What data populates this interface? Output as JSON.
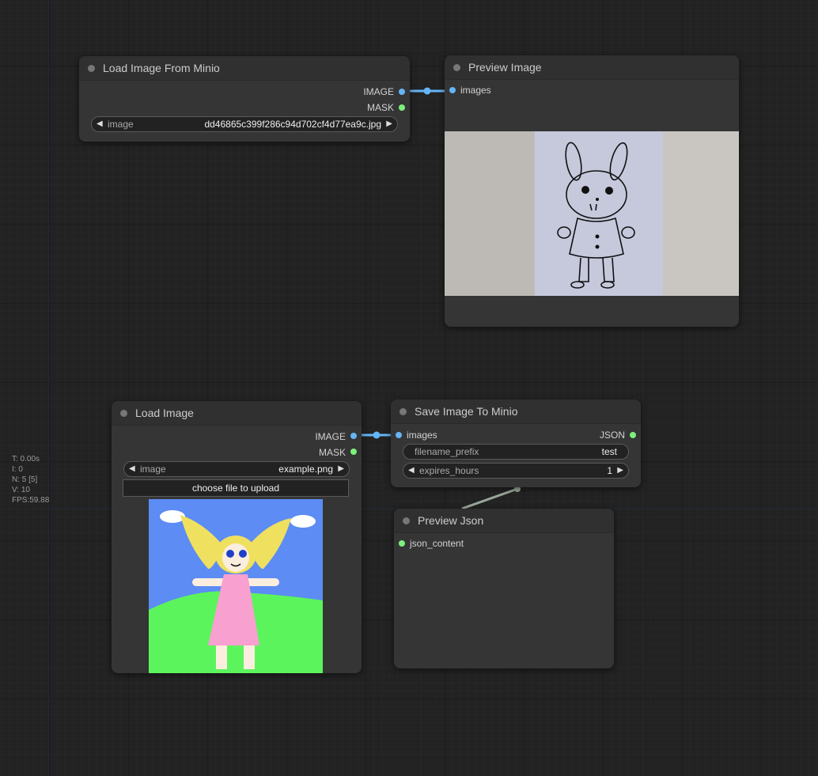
{
  "stats": [
    "T: 0.00s",
    "I: 0",
    "N: 5 [5]",
    "V: 10",
    "FPS:59.88"
  ],
  "nodes": {
    "load_minio": {
      "title": "Load Image From Minio",
      "outputs": [
        "IMAGE",
        "MASK"
      ],
      "widget": {
        "label": "image",
        "value": "dd46865c399f286c94d702cf4d77ea9c.jpg"
      }
    },
    "preview_image": {
      "title": "Preview Image",
      "inputs": [
        "images"
      ],
      "image_icon": "rabbit-drawing-photo"
    },
    "load_image": {
      "title": "Load Image",
      "outputs": [
        "IMAGE",
        "MASK"
      ],
      "widget": {
        "label": "image",
        "value": "example.png"
      },
      "upload_label": "choose file to upload",
      "image_icon": "girl-drawing-image"
    },
    "save_minio": {
      "title": "Save Image To Minio",
      "inputs": [
        "images"
      ],
      "outputs": [
        "JSON"
      ],
      "widgets": [
        {
          "label": "filename_prefix",
          "value": "test"
        },
        {
          "label": "expires_hours",
          "value": "1"
        }
      ]
    },
    "preview_json": {
      "title": "Preview Json",
      "inputs": [
        "json_content"
      ]
    }
  },
  "colors": {
    "image_slot": "#64b5f6",
    "mask_slot": "#7cf07c",
    "link": "#64b5f6",
    "json_link": "#a0b0a0"
  }
}
